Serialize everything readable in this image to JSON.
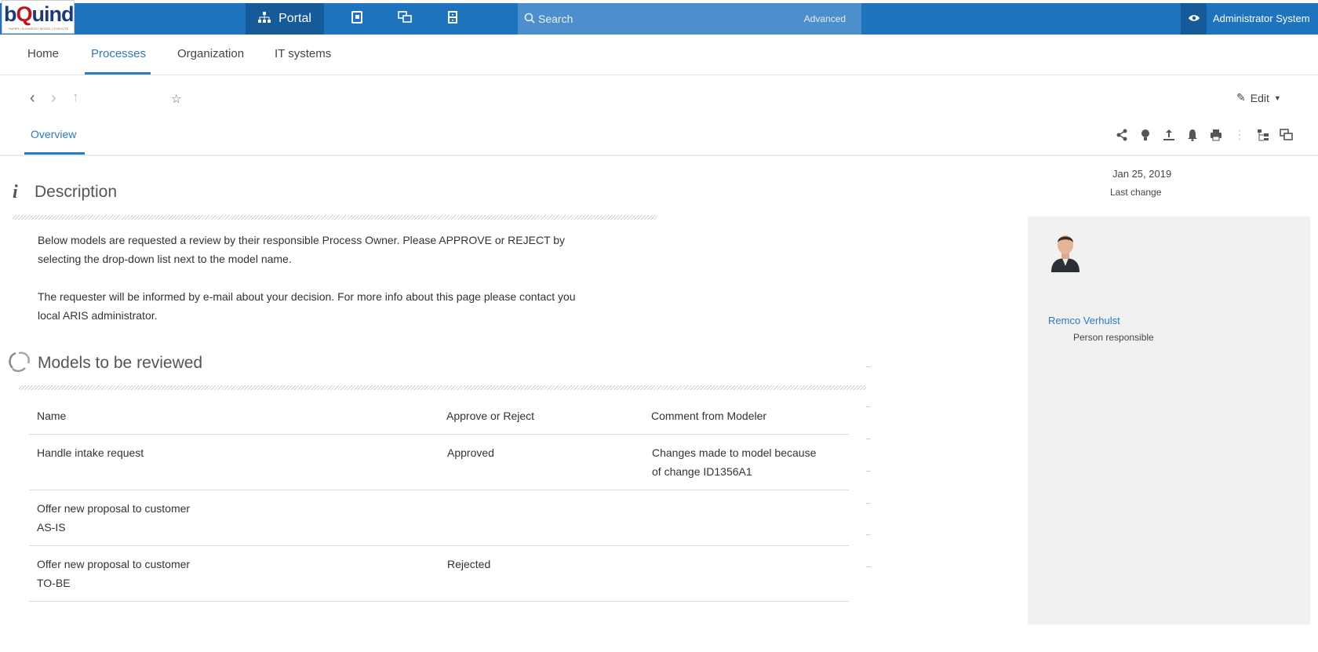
{
  "topbar": {
    "logo_text": "bQuind",
    "logo_tagline": "PAPER | BUSINESS | MODEL | EXECUTE",
    "portal_label": "Portal",
    "search_placeholder": "Search",
    "advanced_label": "Advanced",
    "user_name": "Administrator System",
    "colors": {
      "bar": "#1e73be",
      "active": "#155a99",
      "search": "#4d8fcd"
    }
  },
  "tabs": [
    {
      "label": "Home"
    },
    {
      "label": "Processes",
      "active": true
    },
    {
      "label": "Organization"
    },
    {
      "label": "IT systems"
    }
  ],
  "toolbar": {
    "edit_label": "Edit",
    "subtab": "Overview"
  },
  "meta": {
    "date": "Jan 25, 2019",
    "date_label": "Last change"
  },
  "person": {
    "name": "Remco Verhulst",
    "role": "Person responsible"
  },
  "description": {
    "title": "Description",
    "p1_line1": "Below models are requested a review by their responsible Process Owner. Please APPROVE or REJECT by",
    "p1_line2": "selecting the drop-down list next to the model name.",
    "p2_line1": "The requester will be informed by e-mail about your decision. For more info about this page please contact you",
    "p2_line2": "local ARIS administrator."
  },
  "models": {
    "title": "Models to be reviewed",
    "columns": [
      "Name",
      "Approve or Reject",
      "Comment from Modeler"
    ],
    "rows": [
      {
        "name_l1": "Handle intake request",
        "name_l2": "",
        "status": "Approved",
        "comment_l1": "Changes made to model because",
        "comment_l2": "of change ID1356A1"
      },
      {
        "name_l1": "Offer new proposal to customer",
        "name_l2": "AS-IS",
        "status": "",
        "comment_l1": "",
        "comment_l2": ""
      },
      {
        "name_l1": "Offer new proposal to customer",
        "name_l2": "TO-BE",
        "status": "Rejected",
        "comment_l1": "",
        "comment_l2": ""
      }
    ]
  }
}
